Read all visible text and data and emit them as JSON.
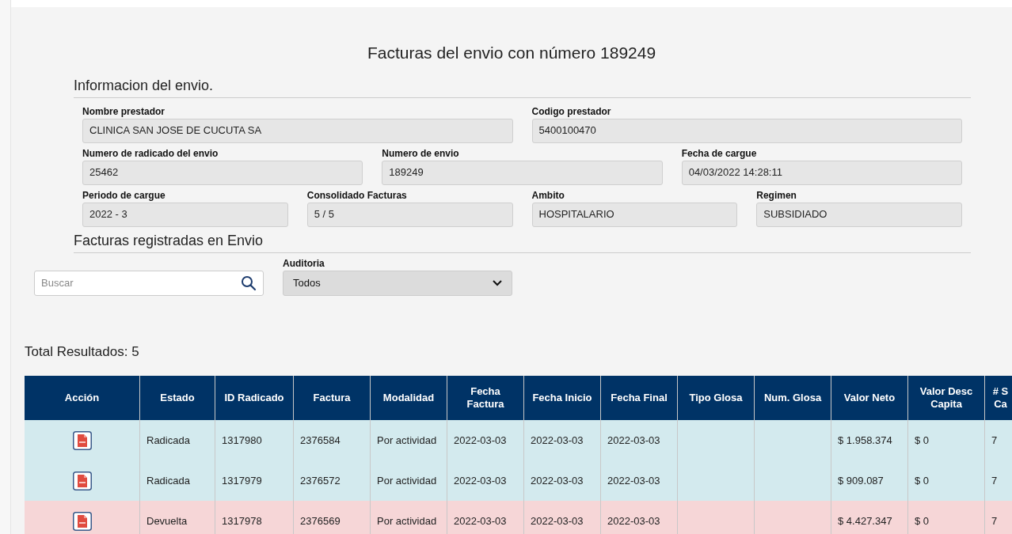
{
  "title": "Facturas del envio con número 189249",
  "info": {
    "heading": "Informacion del envio.",
    "rows": [
      [
        {
          "label": "Nombre prestador",
          "value": "CLINICA SAN JOSE DE CUCUTA SA"
        },
        {
          "label": "Codigo prestador",
          "value": "5400100470"
        }
      ],
      [
        {
          "label": "Numero de radicado del envio",
          "value": "25462"
        },
        {
          "label": "Numero de envio",
          "value": "189249"
        },
        {
          "label": "Fecha de cargue",
          "value": "04/03/2022 14:28:11"
        }
      ],
      [
        {
          "label": "Periodo de cargue",
          "value": "2022 - 3"
        },
        {
          "label": "Consolidado Facturas",
          "value": "5 / 5"
        },
        {
          "label": "Ambito",
          "value": "HOSPITALARIO"
        },
        {
          "label": "Regimen",
          "value": "SUBSIDIADO"
        }
      ]
    ]
  },
  "invoices": {
    "heading": "Facturas registradas en Envio",
    "search": {
      "placeholder": "Buscar"
    },
    "audit": {
      "label": "Auditoria",
      "value": "Todos"
    },
    "total": "Total Resultados: 5",
    "table": {
      "columns": [
        "Acción",
        "Estado",
        "ID Radicado",
        "Factura",
        "Modalidad",
        "Fecha Factura",
        "Fecha Inicio",
        "Fecha Final",
        "Tipo Glosa",
        "Num. Glosa",
        "Valor Neto",
        "Valor Desc Capita",
        "# S Ca"
      ],
      "rows": [
        {
          "color": "#d3eaee",
          "cells": [
            "",
            "Radicada",
            "1317980",
            "2376584",
            "Por actividad",
            "2022-03-03",
            "2022-03-03",
            "2022-03-03",
            "",
            "",
            "$ 1.958.374",
            "$ 0",
            "7"
          ]
        },
        {
          "color": "#d3eaee",
          "cells": [
            "",
            "Radicada",
            "1317979",
            "2376572",
            "Por actividad",
            "2022-03-03",
            "2022-03-03",
            "2022-03-03",
            "",
            "",
            "$ 909.087",
            "$ 0",
            "7"
          ]
        },
        {
          "color": "#f6d6d7",
          "cells": [
            "",
            "Devuelta",
            "1317978",
            "2376569",
            "Por actividad",
            "2022-03-03",
            "2022-03-03",
            "2022-03-03",
            "",
            "",
            "$ 4.427.347",
            "$ 0",
            "7"
          ]
        }
      ]
    }
  }
}
